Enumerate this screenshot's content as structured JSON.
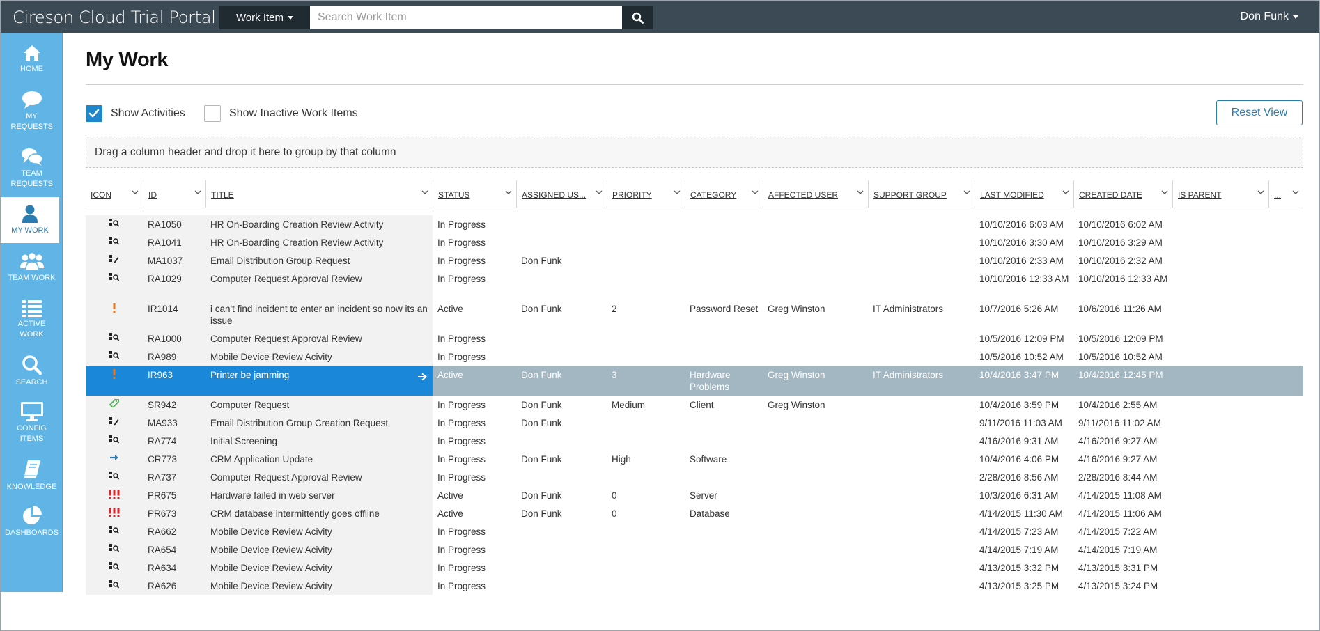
{
  "header": {
    "app_title": "Cireson Cloud Trial Portal",
    "work_item_dropdown": "Work Item",
    "search_placeholder": "Search Work Item",
    "user_name": "Don Funk"
  },
  "sidebar": {
    "items": [
      {
        "label": "HOME",
        "icon": "home-icon"
      },
      {
        "label": "MY REQUESTS",
        "icon": "speech-bubble-icon"
      },
      {
        "label": "TEAM REQUESTS",
        "icon": "speech-bubbles-icon"
      },
      {
        "label": "MY WORK",
        "icon": "user-icon",
        "active": true
      },
      {
        "label": "TEAM WORK",
        "icon": "users-icon"
      },
      {
        "label": "ACTIVE WORK",
        "icon": "list-icon"
      },
      {
        "label": "SEARCH",
        "icon": "search-icon"
      },
      {
        "label": "CONFIG ITEMS",
        "icon": "monitor-icon"
      },
      {
        "label": "KNOWLEDGE",
        "icon": "book-icon"
      },
      {
        "label": "DASHBOARDS",
        "icon": "pie-chart-icon"
      }
    ]
  },
  "page": {
    "title": "My Work",
    "show_activities_label": "Show Activities",
    "show_activities_checked": true,
    "show_inactive_label": "Show Inactive Work Items",
    "show_inactive_checked": false,
    "reset_view_label": "Reset View",
    "group_panel_text": "Drag a column header and drop it here to group by that column"
  },
  "grid": {
    "columns": [
      "ICON",
      "ID",
      "TITLE",
      "STATUS",
      "ASSIGNED US...",
      "PRIORITY",
      "CATEGORY",
      "AFFECTED USER",
      "SUPPORT GROUP",
      "LAST MODIFIED",
      "CREATED DATE",
      "IS PARENT",
      "..."
    ],
    "rows": [
      {
        "icon": "review-activity-icon",
        "id": "RA1050",
        "title": "HR On-Boarding Creation Review Activity",
        "status": "In Progress",
        "assigned": "",
        "priority": "",
        "category": "",
        "affected_user": "",
        "support_group": "",
        "last_modified": "10/10/2016 6:03 AM",
        "created": "10/10/2016 6:02 AM",
        "is_parent": ""
      },
      {
        "icon": "review-activity-icon",
        "id": "RA1041",
        "title": "HR On-Boarding Creation Review Activity",
        "status": "In Progress",
        "assigned": "",
        "priority": "",
        "category": "",
        "affected_user": "",
        "support_group": "",
        "last_modified": "10/10/2016 3:30 AM",
        "created": "10/10/2016 3:29 AM",
        "is_parent": ""
      },
      {
        "icon": "manual-activity-icon",
        "id": "MA1037",
        "title": "Email Distribution Group Request",
        "status": "In Progress",
        "assigned": "Don Funk",
        "priority": "",
        "category": "",
        "affected_user": "",
        "support_group": "",
        "last_modified": "10/10/2016 2:33 AM",
        "created": "10/10/2016 2:32 AM",
        "is_parent": ""
      },
      {
        "icon": "review-activity-icon",
        "id": "RA1029",
        "title": "Computer Request Approval Review",
        "status": "In Progress",
        "assigned": "",
        "priority": "",
        "category": "",
        "affected_user": "",
        "support_group": "",
        "last_modified": "10/10/2016 12:33 AM",
        "created": "10/10/2016 12:33 AM",
        "is_parent": ""
      },
      {
        "icon": "incident-icon",
        "id": "IR1014",
        "title": "i can't find incident to enter an incident so now its an issue",
        "status": "Active",
        "assigned": "Don Funk",
        "priority": "2",
        "category": "Password Reset",
        "affected_user": "Greg Winston",
        "support_group": "IT Administrators",
        "last_modified": "10/7/2016 5:26 AM",
        "created": "10/6/2016 11:26 AM",
        "is_parent": ""
      },
      {
        "icon": "review-activity-icon",
        "id": "RA1000",
        "title": "Computer Request Approval Review",
        "status": "In Progress",
        "assigned": "",
        "priority": "",
        "category": "",
        "affected_user": "",
        "support_group": "",
        "last_modified": "10/5/2016 12:09 PM",
        "created": "10/5/2016 12:09 PM",
        "is_parent": ""
      },
      {
        "icon": "review-activity-icon",
        "id": "RA989",
        "title": "Mobile Device Review Acivity",
        "status": "In Progress",
        "assigned": "",
        "priority": "",
        "category": "",
        "affected_user": "",
        "support_group": "",
        "last_modified": "10/5/2016 10:52 AM",
        "created": "10/5/2016 10:52 AM",
        "is_parent": ""
      },
      {
        "icon": "incident-icon",
        "id": "IR963",
        "title": "Printer be jamming",
        "status": "Active",
        "assigned": "Don Funk",
        "priority": "3",
        "category": "Hardware Problems",
        "affected_user": "Greg Winston",
        "support_group": "IT Administrators",
        "last_modified": "10/4/2016 3:47 PM",
        "created": "10/4/2016 12:45 PM",
        "is_parent": "",
        "selected": true
      },
      {
        "icon": "service-request-icon",
        "id": "SR942",
        "title": "Computer Request",
        "status": "In Progress",
        "assigned": "Don Funk",
        "priority": "Medium",
        "category": "Client",
        "affected_user": "Greg Winston",
        "support_group": "",
        "last_modified": "10/4/2016 3:59 PM",
        "created": "10/4/2016 2:55 AM",
        "is_parent": ""
      },
      {
        "icon": "manual-activity-icon",
        "id": "MA933",
        "title": "Email Distribution Group Creation Request",
        "status": "In Progress",
        "assigned": "Don Funk",
        "priority": "",
        "category": "",
        "affected_user": "",
        "support_group": "",
        "last_modified": "9/11/2016 11:03 AM",
        "created": "9/11/2016 11:02 AM",
        "is_parent": ""
      },
      {
        "icon": "review-activity-icon",
        "id": "RA774",
        "title": "Initial Screening",
        "status": "In Progress",
        "assigned": "",
        "priority": "",
        "category": "",
        "affected_user": "",
        "support_group": "",
        "last_modified": "4/16/2016 9:31 AM",
        "created": "4/16/2016 9:27 AM",
        "is_parent": ""
      },
      {
        "icon": "change-request-icon",
        "id": "CR773",
        "title": "CRM Application Update",
        "status": "In Progress",
        "assigned": "Don Funk",
        "priority": "High",
        "category": "Software",
        "affected_user": "",
        "support_group": "",
        "last_modified": "10/4/2016 4:06 PM",
        "created": "4/16/2016 9:27 AM",
        "is_parent": ""
      },
      {
        "icon": "review-activity-icon",
        "id": "RA737",
        "title": "Computer Request Approval Review",
        "status": "In Progress",
        "assigned": "",
        "priority": "",
        "category": "",
        "affected_user": "",
        "support_group": "",
        "last_modified": "2/28/2016 8:56 AM",
        "created": "2/28/2016 8:44 AM",
        "is_parent": ""
      },
      {
        "icon": "problem-icon",
        "id": "PR675",
        "title": "Hardware failed in web server",
        "status": "Active",
        "assigned": "Don Funk",
        "priority": "0",
        "category": "Server",
        "affected_user": "",
        "support_group": "",
        "last_modified": "10/3/2016 6:31 AM",
        "created": "4/14/2015 11:08 AM",
        "is_parent": ""
      },
      {
        "icon": "problem-icon",
        "id": "PR673",
        "title": "CRM database intermittently goes offline",
        "status": "Active",
        "assigned": "Don Funk",
        "priority": "0",
        "category": "Database",
        "affected_user": "",
        "support_group": "",
        "last_modified": "4/14/2015 11:30 AM",
        "created": "4/14/2015 11:06 AM",
        "is_parent": ""
      },
      {
        "icon": "review-activity-icon",
        "id": "RA662",
        "title": "Mobile Device Review Acivity",
        "status": "In Progress",
        "assigned": "",
        "priority": "",
        "category": "",
        "affected_user": "",
        "support_group": "",
        "last_modified": "4/14/2015 7:23 AM",
        "created": "4/14/2015 7:22 AM",
        "is_parent": ""
      },
      {
        "icon": "review-activity-icon",
        "id": "RA654",
        "title": "Mobile Device Review Acivity",
        "status": "In Progress",
        "assigned": "",
        "priority": "",
        "category": "",
        "affected_user": "",
        "support_group": "",
        "last_modified": "4/14/2015 7:19 AM",
        "created": "4/14/2015 7:19 AM",
        "is_parent": ""
      },
      {
        "icon": "review-activity-icon",
        "id": "RA634",
        "title": "Mobile Device Review Acivity",
        "status": "In Progress",
        "assigned": "",
        "priority": "",
        "category": "",
        "affected_user": "",
        "support_group": "",
        "last_modified": "4/13/2015 3:32 PM",
        "created": "4/13/2015 3:31 PM",
        "is_parent": ""
      },
      {
        "icon": "review-activity-icon",
        "id": "RA626",
        "title": "Mobile Device Review Acivity",
        "status": "In Progress",
        "assigned": "",
        "priority": "",
        "category": "",
        "affected_user": "",
        "support_group": "",
        "last_modified": "4/13/2015 3:25 PM",
        "created": "4/13/2015 3:24 PM",
        "is_parent": ""
      }
    ]
  },
  "colors": {
    "topbar": "#3b4a55",
    "sidebar": "#60b5e6",
    "accent": "#1f86c9",
    "selected_row_left": "#1a87d8",
    "selected_row_right": "#a3b7c3",
    "incident_orange": "#e87722",
    "problem_red": "#d9262c",
    "service_request_green": "#4caf50",
    "change_blue": "#2a7db3"
  }
}
